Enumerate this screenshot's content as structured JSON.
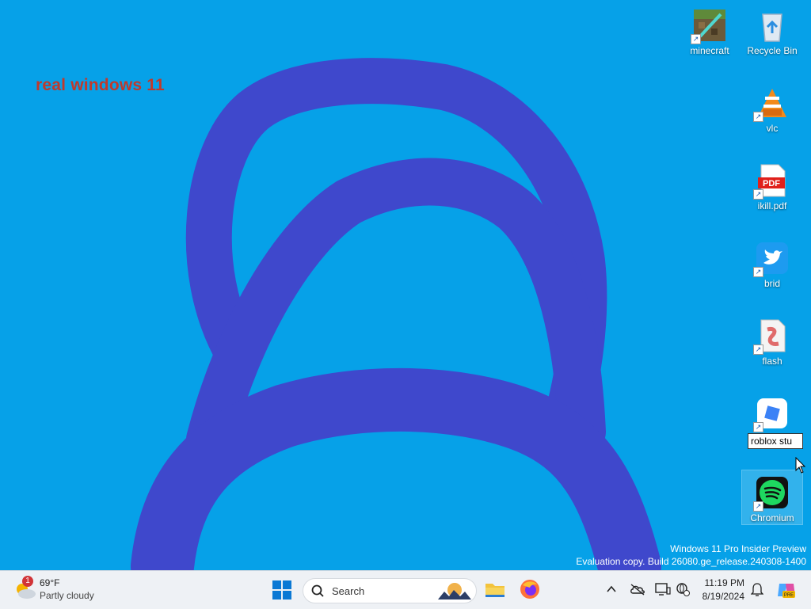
{
  "desktop": {
    "painted_text": "real windows 11",
    "icons": [
      {
        "label": "minecraft",
        "icon": "minecraft-icon"
      },
      {
        "label": "Recycle Bin",
        "icon": "recycle-bin-icon"
      },
      {
        "label": "vlc",
        "icon": "vlc-icon"
      },
      {
        "label": "ikill.pdf",
        "icon": "pdf-icon"
      },
      {
        "label": "brid",
        "icon": "twitter-bird-icon"
      },
      {
        "label": "flash",
        "icon": "flash-file-icon"
      },
      {
        "label": "roblox stu",
        "icon": "roblox-studio-icon"
      },
      {
        "label": "Chromium",
        "icon": "spotify-icon"
      }
    ],
    "watermark": {
      "line1": "Windows 11 Pro Insider Preview",
      "line2": "Evaluation copy. Build 26080.ge_release.240308-1400"
    }
  },
  "taskbar": {
    "weather": {
      "temp": "69°F",
      "desc": "Partly cloudy",
      "badge": "1"
    },
    "search_placeholder": "Search",
    "clock": {
      "time": "11:19 PM",
      "date": "8/19/2024"
    },
    "colors": {
      "taskbar_bg": "#eef1f5",
      "accent": "#0078d4"
    }
  }
}
